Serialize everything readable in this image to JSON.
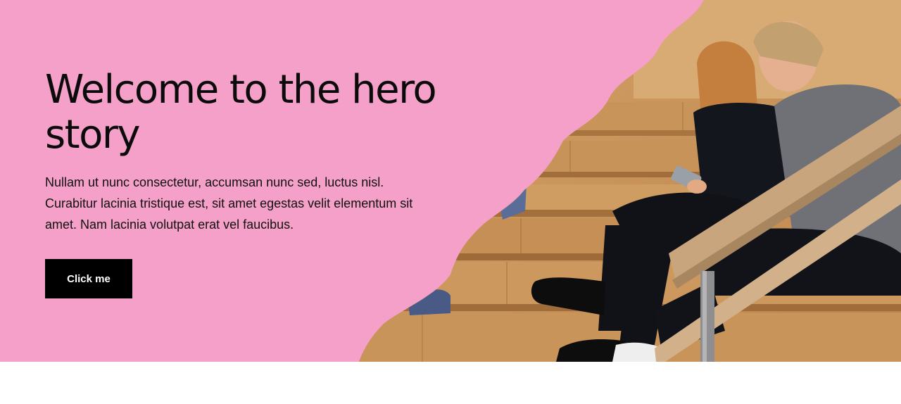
{
  "hero": {
    "title_line1": "Welcome to the hero",
    "title_line2": "story",
    "description_line1": "Nullam ut nunc consectetur, accumsan nunc sed, luctus nisl.",
    "description_line2": "Curabitur lacinia tristique est, sit amet egestas velit elementum sit",
    "description_line3": "amet. Nam lacinia volutpat erat vel faucibus.",
    "button_label": "Click me",
    "colors": {
      "background": "#f4a0c8",
      "button": "#000000",
      "button_text": "#ffffff",
      "text": "#0b0b0b"
    },
    "image": "people-on-wooden-stairs-photo"
  }
}
